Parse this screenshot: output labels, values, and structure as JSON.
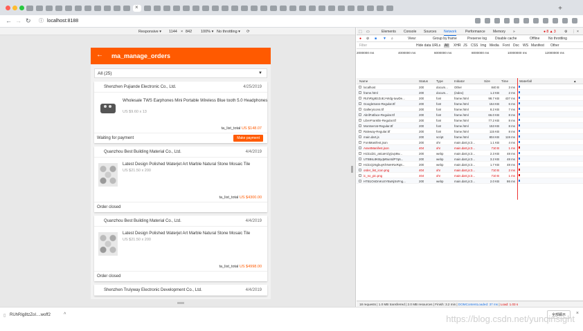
{
  "browser": {
    "url": "localhost:8188",
    "traffic_colors": [
      "#ff5f57",
      "#febc2e",
      "#28c840"
    ],
    "new_tab_label": "+"
  },
  "device_toolbar": {
    "mode": "Responsive ▾",
    "width": "1144",
    "times": "×",
    "height": "842",
    "zoom": "100% ▾",
    "throttle": "No throttling ▾"
  },
  "app": {
    "accent": "#ff5a00",
    "back_icon": "←",
    "title": "ma_manage_orders",
    "filter": {
      "selected": "All (25)",
      "caret": "▼"
    },
    "orders": [
      {
        "shop": "Shenzhen Pujiande Electronic Co., Ltd.",
        "date": "4/25/2019",
        "image": "earbuds",
        "product": "Wholesale TWS Earphones Mini Portable Wireless Blue tooth 5.0 Headphones",
        "price": "US $9.60 x 13",
        "total_label": "ta_list_total",
        "total_value": "US $148.07",
        "status": "Waiting for payment",
        "action": "Make payment"
      },
      {
        "shop": "Quanzhou Best Building Material Co., Ltd.",
        "date": "4/4/2019",
        "image": "tile",
        "product": "Latest Design Polished  Waterjet Art Marble Natural Stone Mosaic Tile",
        "price": "US $21.50 x 200",
        "total_label": "ta_list_total",
        "total_value": "US $4300.00",
        "status": "Order closed",
        "action": ""
      },
      {
        "shop": "Quanzhou Best Building Material Co., Ltd.",
        "date": "4/4/2019",
        "image": "tile",
        "product": "Latest Design Polished  Waterjet Art Marble Natural Stone Mosaic Tile",
        "price": "US $21.50 x 200",
        "total_label": "ta_list_total",
        "total_value": "US $4998.00",
        "status": "Order closed",
        "action": ""
      },
      {
        "shop": "Shenzhen Trulyway Electronic Development Co., Ltd.",
        "date": "4/4/2019"
      }
    ]
  },
  "devtools": {
    "tabs": [
      "Elements",
      "Console",
      "Sources",
      "Network",
      "Performance",
      "Memory",
      "»"
    ],
    "active_tab": "Network",
    "badge": "● 8 ▲ 3",
    "controls": {
      "view": "View:",
      "group": "Group by frame",
      "preserve": "Preserve log",
      "cache": "Disable cache",
      "offline": "Offline",
      "throttle": "No throttling"
    },
    "filter_placeholder": "Filter",
    "filter_types": [
      "Hide data URLs",
      "All",
      "XHR",
      "JS",
      "CSS",
      "Img",
      "Media",
      "Font",
      "Doc",
      "WS",
      "Manifest",
      "Other"
    ],
    "timeline": [
      "2000000 ms",
      "4000000 ms",
      "6000000 ms",
      "8000000 ms",
      "10000000 ms",
      "12000000 ms"
    ],
    "columns": [
      "Name",
      "Status",
      "Type",
      "Initiator",
      "Size",
      "Time",
      "Waterfall"
    ],
    "requests": [
      {
        "name": "localhost",
        "status": "200",
        "type": "docum...",
        "initiator": "Other",
        "size": "840 B",
        "time": "3 ms",
        "error": false
      },
      {
        "name": "frame.html",
        "status": "200",
        "type": "docum...",
        "initiator": "(index)",
        "size": "1.2 KB",
        "time": "2 ms",
        "error": false
      },
      {
        "name": "RUhRIg8tzZoEJ-Wdg-tuwDe...",
        "status": "200",
        "type": "font",
        "initiator": "frame.html",
        "size": "98.7 KB",
        "time": "437 ms",
        "error": false
      },
      {
        "name": "GoogleSans-Regular.ttf",
        "status": "200",
        "type": "font",
        "initiator": "frame.html",
        "size": "154 KB",
        "time": "6 ms",
        "error": false
      },
      {
        "name": "Galleryicons.ttf",
        "status": "200",
        "type": "font",
        "initiator": "frame.html",
        "size": "8.2 KB",
        "time": "7 ms",
        "error": false
      },
      {
        "name": "AbrilFatface-Regular.ttf",
        "status": "200",
        "type": "font",
        "initiator": "frame.html",
        "size": "66.0 KB",
        "time": "8 ms",
        "error": false
      },
      {
        "name": "LibreFranklin-Regular.ttf",
        "status": "200",
        "type": "font",
        "initiator": "frame.html",
        "size": "77.2 KB",
        "time": "8 ms",
        "error": false
      },
      {
        "name": "Montserrat-Regular.ttf",
        "status": "200",
        "type": "font",
        "initiator": "frame.html",
        "size": "153 KB",
        "time": "8 ms",
        "error": false
      },
      {
        "name": "Raleway-Regular.ttf",
        "status": "200",
        "type": "font",
        "initiator": "frame.html",
        "size": "115 KB",
        "time": "8 ms",
        "error": false
      },
      {
        "name": "main.dart.js",
        "status": "200",
        "type": "script",
        "initiator": "frame.html",
        "size": "804 KB",
        "time": "119 ms",
        "error": false
      },
      {
        "name": "FontManifest.json",
        "status": "200",
        "type": "xhr",
        "initiator": "main.dart.js:3...",
        "size": "1.1 KB",
        "time": "4 ms",
        "error": false
      },
      {
        "name": "AssetManifest.json",
        "status": "404",
        "type": "xhr",
        "initiator": "main.dart.js:3...",
        "size": "710 B",
        "time": "1 ms",
        "error": true
      },
      {
        "name": "H1b1d21_a61aH1lyj1vp8w...",
        "status": "200",
        "type": "webp",
        "initiator": "main.dart.js:3...",
        "size": "2.3 KB",
        "time": "48 ms",
        "error": false
      },
      {
        "name": "UTB8sL8KByqM5uI4dP7q6...",
        "status": "200",
        "type": "webp",
        "initiator": "main.dart.js:3...",
        "size": "3.2 KB",
        "time": "48 ms",
        "error": false
      },
      {
        "name": "H1b1Qz6gbuyKhNeHNxRq8...",
        "status": "200",
        "type": "webp",
        "initiator": "main.dart.js:3...",
        "size": "1.7 KB",
        "time": "48 ms",
        "error": false
      },
      {
        "name": "order_list_icon.png",
        "status": "404",
        "type": "xhr",
        "initiator": "main.dart.js:3...",
        "size": "710 B",
        "time": "2 ms",
        "error": true
      },
      {
        "name": "ic_no_pic.png",
        "status": "404",
        "type": "xhr",
        "initiator": "main.dart.js:3...",
        "size": "710 B",
        "time": "1 ms",
        "error": true
      },
      {
        "name": "HTB1OnDmKxSYBuNjSsFng...",
        "status": "200",
        "type": "webp",
        "initiator": "main.dart.js:3...",
        "size": "2.0 KB",
        "time": "86 ms",
        "error": false
      }
    ],
    "status_text": "18 requests | 1.0 MB transferred | 2.0 MB resources | Finish: 3.2 min |",
    "dom_loaded": "DOMContentLoaded: 37 ms",
    "load": "Load: 1.03 s"
  },
  "downloads": {
    "file": "RUhRIg8tzZoI....woff2",
    "caret": "^",
    "show_all": "全部顯示",
    "close": "×"
  },
  "watermark": "https://blog.csdn.net/yunqinsight"
}
